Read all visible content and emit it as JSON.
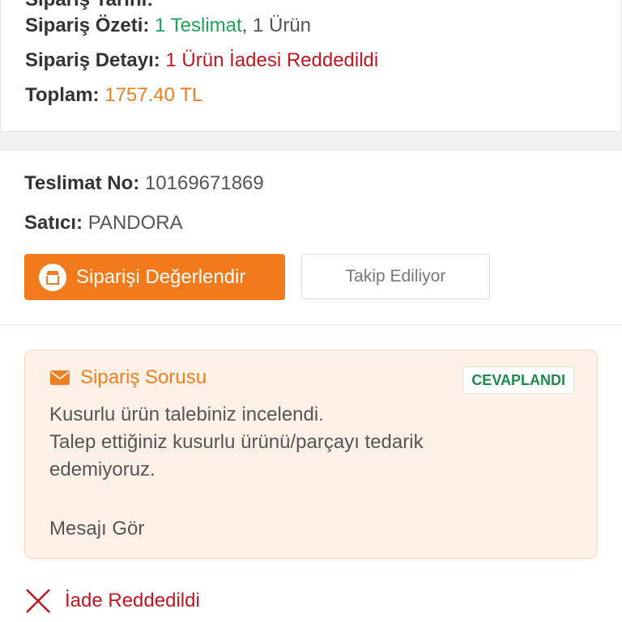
{
  "order_summary": {
    "cut_top_row": "Sipariş Tarihi:",
    "summary_label": "Sipariş Özeti:",
    "summary_delivery": "1 Teslimat",
    "summary_sep": ",",
    "summary_items": " 1 Ürün",
    "detail_label": "Sipariş Detayı:",
    "detail_value": "1 Ürün İadesi Reddedildi",
    "total_label": "Toplam:",
    "total_value": "1757.40 TL"
  },
  "delivery": {
    "number_label": "Teslimat No:",
    "number_value": "10169671869",
    "seller_label": "Satıcı:",
    "seller_value": "PANDORA",
    "rate_button": "Siparişi Değerlendir",
    "follow_button": "Takip Ediliyor"
  },
  "question": {
    "title": "Sipariş Sorusu",
    "badge": "CEVAPLANDI",
    "lines": [
      "Kusurlu ürün talebiniz incelendi.",
      "Talep ettiğiniz kusurlu ürünü/parçayı tedarik",
      "edemiyoruz."
    ],
    "link": "Mesajı Gör"
  },
  "return_status": {
    "text": "İade Reddedildi"
  },
  "colors": {
    "accent_orange": "#f27a1a",
    "green": "#21a35a",
    "red": "#c0161f"
  },
  "icons": [
    "store-icon",
    "envelope-icon",
    "close-x-icon"
  ]
}
